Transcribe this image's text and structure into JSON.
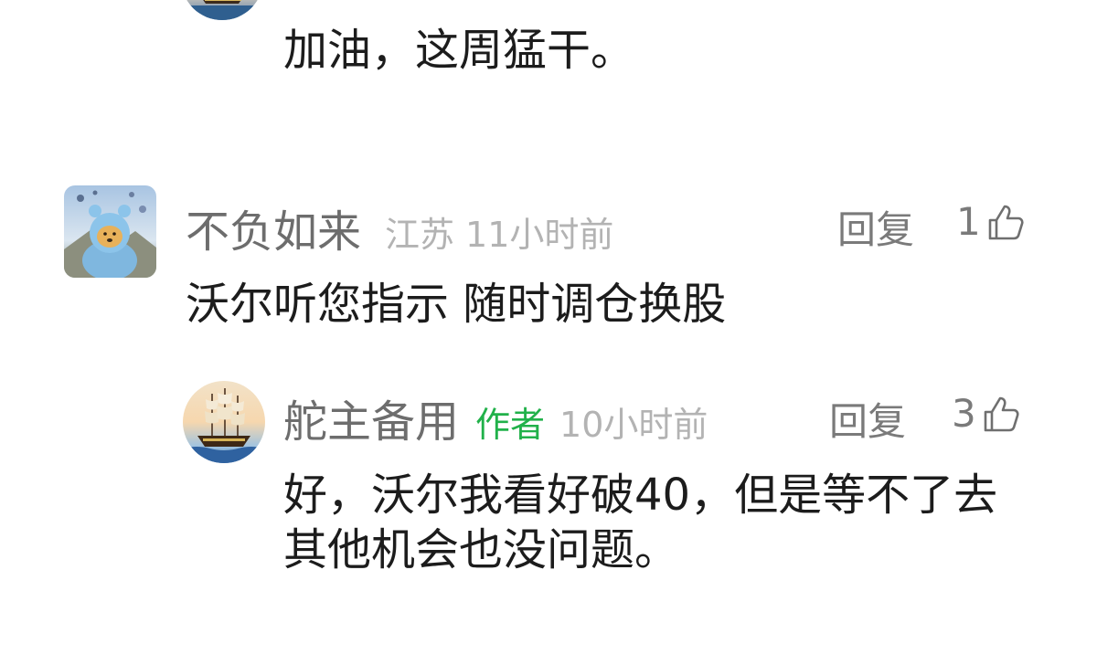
{
  "comments": [
    {
      "text": "加油，这周猛干。"
    },
    {
      "username": "不负如来",
      "location": "江苏",
      "time": "11小时前",
      "text": "沃尔听您指示 随时调仓换股",
      "reply_label": "回复",
      "likes": "1",
      "avatar_icon": "bear-avatar-icon"
    },
    {
      "username": "舵主备用",
      "badge": "作者",
      "time": "10小时前",
      "text": "好，沃尔我看好破40，但是等不了去其他机会也没问题。",
      "reply_label": "回复",
      "likes": "3",
      "avatar_icon": "sailing-ship-avatar-icon"
    }
  ],
  "colors": {
    "author_badge": "#21b14a",
    "meta_gray": "#b3b3b3",
    "username_gray": "#6d6d6d"
  }
}
